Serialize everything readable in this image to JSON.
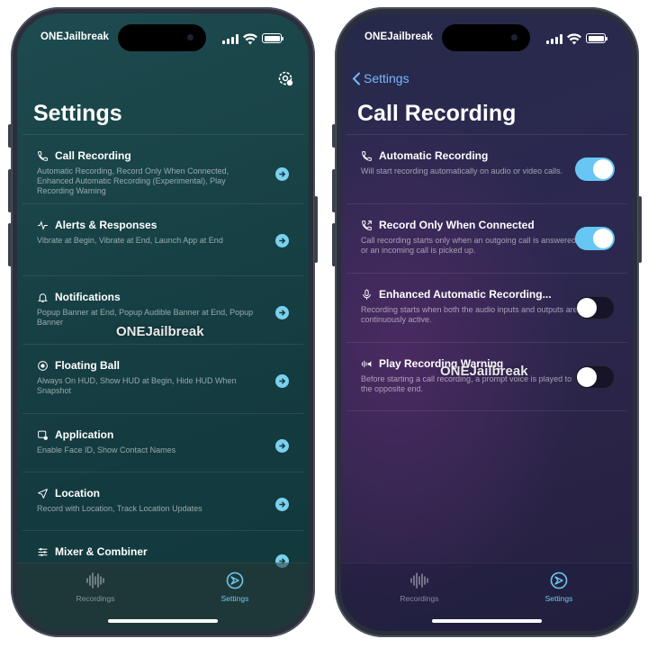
{
  "left_phone": {
    "status": {
      "carrier": "ONEJailbreak"
    },
    "title": "Settings",
    "watermark": "ONEJailbreak",
    "items": [
      {
        "label": "Call Recording",
        "icon": "phone-icon",
        "desc": "Automatic Recording, Record Only When Connected, Enhanced Automatic Recording (Experimental), Play Recording Warning"
      },
      {
        "label": "Alerts & Responses",
        "icon": "waveform-alert-icon",
        "desc": "Vibrate at Begin, Vibrate at End, Launch App at End"
      },
      {
        "label": "Notifications",
        "icon": "bell-icon",
        "desc": "Popup Banner at End, Popup Audible Banner at End, Popup Banner"
      },
      {
        "label": "Floating Ball",
        "icon": "record-circle-icon",
        "desc": "Always On HUD, Show HUD at Begin, Hide HUD When Snapshot"
      },
      {
        "label": "Application",
        "icon": "app-settings-icon",
        "desc": "Enable Face ID, Show Contact Names"
      },
      {
        "label": "Location",
        "icon": "location-arrow-icon",
        "desc": "Record with Location, Track Location Updates"
      },
      {
        "label": "Mixer & Combiner",
        "icon": "sliders-icon",
        "desc": ""
      }
    ],
    "tabs": [
      {
        "label": "Recordings",
        "icon": "waveform-icon",
        "active": false
      },
      {
        "label": "Settings",
        "icon": "settings-gear-icon",
        "active": true
      }
    ]
  },
  "right_phone": {
    "status": {
      "carrier": "ONEJailbreak"
    },
    "back_label": "Settings",
    "title": "Call Recording",
    "watermark": "ONEJailbreak",
    "items": [
      {
        "label": "Automatic Recording",
        "icon": "phone-icon",
        "desc": "Will start recording automatically on audio or video calls.",
        "on": true
      },
      {
        "label": "Record Only When Connected",
        "icon": "phone-connected-icon",
        "desc": "Call recording starts only when an outgoing call is answered or an incoming call is picked up.",
        "on": true
      },
      {
        "label": "Enhanced Automatic Recording...",
        "icon": "mic-icon",
        "desc": "Recording starts when both the audio inputs and outputs are continuously active.",
        "on": false
      },
      {
        "label": "Play Recording Warning",
        "icon": "waveform-speaker-icon",
        "desc": "Before starting a call recording, a prompt voice is played to the opposite end.",
        "on": false
      }
    ],
    "tabs": [
      {
        "label": "Recordings",
        "icon": "waveform-icon",
        "active": false
      },
      {
        "label": "Settings",
        "icon": "settings-gear-icon",
        "active": true
      }
    ]
  },
  "colors": {
    "accent": "#6fc8ef",
    "toggle_on": "#67c6f3",
    "back_link": "#7ab6ff"
  }
}
